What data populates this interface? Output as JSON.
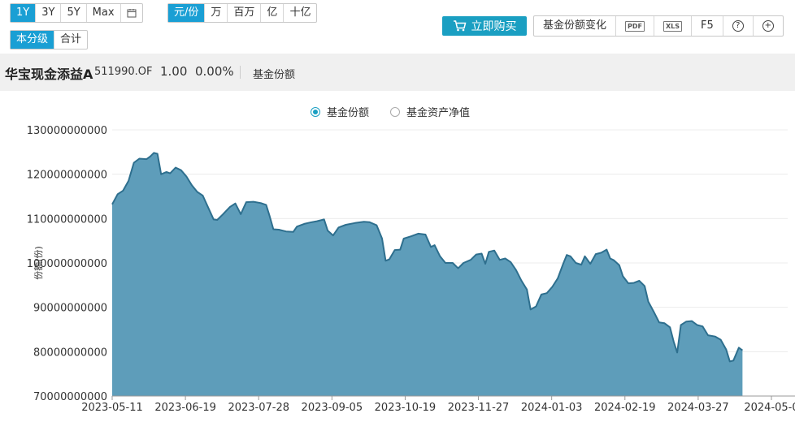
{
  "toolbar": {
    "range_buttons": [
      "1Y",
      "3Y",
      "5Y",
      "Max"
    ],
    "range_active": "1Y",
    "calendar_icon": "calendar-icon",
    "unit_buttons": [
      "元/份",
      "万",
      "百万",
      "亿",
      "十亿"
    ],
    "unit_active": "元/份",
    "class_buttons": [
      "本分级",
      "合计"
    ],
    "class_active": "本分级",
    "buy_label": "立即购买",
    "buy_icon": "cart-icon",
    "tool_change_label": "基金份额变化",
    "tool_pdf": "PDF",
    "tool_xls": "XLS",
    "tool_f5": "F5",
    "tool_help": "?",
    "tool_add": "+",
    "accent_color": "#1a9fd4",
    "buy_color": "#1a9fc2"
  },
  "fund": {
    "name": "华宝现金添益A",
    "code": "511990.OF",
    "value": "1.00",
    "change": "0.00%",
    "metric": "基金份额"
  },
  "legend": {
    "share": "基金份额",
    "nav": "基金资产净值",
    "selected": "share"
  },
  "chart_data": {
    "type": "area",
    "ylabel": "份额(份)",
    "ylim": [
      70000000000,
      130000000000
    ],
    "yticks": [
      "130000000000",
      "120000000000",
      "110000000000",
      "100000000000",
      "90000000000",
      "80000000000",
      "70000000000"
    ],
    "xticks": [
      "2023-05-11",
      "2023-06-19",
      "2023-07-28",
      "2023-09-05",
      "2023-10-19",
      "2023-11-27",
      "2024-01-03",
      "2024-02-19",
      "2024-03-27",
      "2024-05-0"
    ],
    "x_start": "2023-05-11",
    "x_end": "2024-05-09",
    "line_color": "#2e6f8e",
    "fill_color": "#5e9dba",
    "series": [
      {
        "values": [
          [
            "2023-05-11",
            113200000000.0
          ],
          [
            "2023-05-14",
            115500000000.0
          ],
          [
            "2023-05-17",
            116300000000.0
          ],
          [
            "2023-05-20",
            118500000000.0
          ],
          [
            "2023-05-23",
            122600000000.0
          ],
          [
            "2023-05-26",
            123500000000.0
          ],
          [
            "2023-05-30",
            123400000000.0
          ],
          [
            "2023-06-01",
            124000000000.0
          ],
          [
            "2023-06-03",
            124800000000.0
          ],
          [
            "2023-06-05",
            124600000000.0
          ],
          [
            "2023-06-07",
            120000000000.0
          ],
          [
            "2023-06-10",
            120500000000.0
          ],
          [
            "2023-06-12",
            120200000000.0
          ],
          [
            "2023-06-15",
            121500000000.0
          ],
          [
            "2023-06-18",
            120900000000.0
          ],
          [
            "2023-06-21",
            119500000000.0
          ],
          [
            "2023-06-24",
            117500000000.0
          ],
          [
            "2023-06-27",
            116000000000.0
          ],
          [
            "2023-06-30",
            115200000000.0
          ],
          [
            "2023-07-03",
            112500000000.0
          ],
          [
            "2023-07-06",
            109800000000.0
          ],
          [
            "2023-07-08",
            109700000000.0
          ],
          [
            "2023-07-11",
            110900000000.0
          ],
          [
            "2023-07-15",
            112600000000.0
          ],
          [
            "2023-07-18",
            113400000000.0
          ],
          [
            "2023-07-21",
            111000000000.0
          ],
          [
            "2023-07-24",
            113700000000.0
          ],
          [
            "2023-07-28",
            113800000000.0
          ],
          [
            "2023-08-01",
            113500000000.0
          ],
          [
            "2023-08-04",
            113100000000.0
          ],
          [
            "2023-08-06",
            110500000000.0
          ],
          [
            "2023-08-08",
            107600000000.0
          ],
          [
            "2023-08-11",
            107500000000.0
          ],
          [
            "2023-08-15",
            107100000000.0
          ],
          [
            "2023-08-19",
            107000000000.0
          ],
          [
            "2023-08-21",
            108200000000.0
          ],
          [
            "2023-08-25",
            108800000000.0
          ],
          [
            "2023-08-28",
            109100000000.0
          ],
          [
            "2023-09-01",
            109400000000.0
          ],
          [
            "2023-09-05",
            109800000000.0
          ],
          [
            "2023-09-07",
            107300000000.0
          ],
          [
            "2023-09-10",
            106200000000.0
          ],
          [
            "2023-09-13",
            108000000000.0
          ],
          [
            "2023-09-17",
            108600000000.0
          ],
          [
            "2023-09-22",
            109000000000.0
          ],
          [
            "2023-09-27",
            109300000000.0
          ],
          [
            "2023-09-30",
            109200000000.0
          ],
          [
            "2023-10-04",
            108500000000.0
          ],
          [
            "2023-10-07",
            105500000000.0
          ],
          [
            "2023-10-09",
            100500000000.0
          ],
          [
            "2023-10-11",
            100800000000.0
          ],
          [
            "2023-10-14",
            102900000000.0
          ],
          [
            "2023-10-17",
            103000000000.0
          ],
          [
            "2023-10-19",
            105500000000.0
          ],
          [
            "2023-10-23",
            106000000000.0
          ],
          [
            "2023-10-27",
            106600000000.0
          ],
          [
            "2023-10-31",
            106400000000.0
          ],
          [
            "2023-11-03",
            103600000000.0
          ],
          [
            "2023-11-05",
            104000000000.0
          ],
          [
            "2023-11-08",
            101500000000.0
          ],
          [
            "2023-11-11",
            100000000000.0
          ],
          [
            "2023-11-15",
            100000000000.0
          ],
          [
            "2023-11-18",
            98800000000.0
          ],
          [
            "2023-11-21",
            100000000000.0
          ],
          [
            "2023-11-25",
            100700000000.0
          ],
          [
            "2023-11-28",
            101900000000.0
          ],
          [
            "2023-12-01",
            102100000000.0
          ],
          [
            "2023-12-03",
            99800000000.0
          ],
          [
            "2023-12-05",
            102500000000.0
          ],
          [
            "2023-12-08",
            102800000000.0
          ],
          [
            "2023-12-11",
            100700000000.0
          ],
          [
            "2023-12-14",
            101000000000.0
          ],
          [
            "2023-12-17",
            100200000000.0
          ],
          [
            "2023-12-20",
            98400000000.0
          ],
          [
            "2023-12-23",
            96000000000.0
          ],
          [
            "2023-12-26",
            94000000000.0
          ],
          [
            "2023-12-28",
            89500000000.0
          ],
          [
            "2023-12-31",
            90200000000.0
          ],
          [
            "2024-01-03",
            92900000000.0
          ],
          [
            "2024-01-06",
            93200000000.0
          ],
          [
            "2024-01-09",
            94600000000.0
          ],
          [
            "2024-01-12",
            96500000000.0
          ],
          [
            "2024-01-15",
            99800000000.0
          ],
          [
            "2024-01-17",
            101800000000.0
          ],
          [
            "2024-01-19",
            101500000000.0
          ],
          [
            "2024-01-22",
            100000000000.0
          ],
          [
            "2024-01-25",
            99600000000.0
          ],
          [
            "2024-01-27",
            101500000000.0
          ],
          [
            "2024-01-30",
            99800000000.0
          ],
          [
            "2024-02-02",
            102000000000.0
          ],
          [
            "2024-02-05",
            102300000000.0
          ],
          [
            "2024-02-08",
            103000000000.0
          ],
          [
            "2024-02-10",
            101000000000.0
          ],
          [
            "2024-02-12",
            100600000000.0
          ],
          [
            "2024-02-15",
            99500000000.0
          ],
          [
            "2024-02-17",
            97000000000.0
          ],
          [
            "2024-02-20",
            95400000000.0
          ],
          [
            "2024-02-23",
            95500000000.0
          ],
          [
            "2024-02-26",
            96000000000.0
          ],
          [
            "2024-02-29",
            94800000000.0
          ],
          [
            "2024-03-02",
            91300000000.0
          ],
          [
            "2024-03-05",
            89000000000.0
          ],
          [
            "2024-03-08",
            86600000000.0
          ],
          [
            "2024-03-11",
            86400000000.0
          ],
          [
            "2024-03-14",
            85500000000.0
          ],
          [
            "2024-03-16",
            82300000000.0
          ],
          [
            "2024-03-18",
            79800000000.0
          ],
          [
            "2024-03-20",
            86000000000.0
          ],
          [
            "2024-03-23",
            86800000000.0
          ],
          [
            "2024-03-26",
            86900000000.0
          ],
          [
            "2024-03-29",
            86000000000.0
          ],
          [
            "2024-04-01",
            85700000000.0
          ],
          [
            "2024-04-04",
            83700000000.0
          ],
          [
            "2024-04-08",
            83400000000.0
          ],
          [
            "2024-04-11",
            82700000000.0
          ],
          [
            "2024-04-14",
            80500000000.0
          ],
          [
            "2024-04-16",
            77800000000.0
          ],
          [
            "2024-04-18",
            78000000000.0
          ],
          [
            "2024-04-21",
            80900000000.0
          ],
          [
            "2024-04-23",
            80300000000.0
          ]
        ]
      }
    ]
  }
}
